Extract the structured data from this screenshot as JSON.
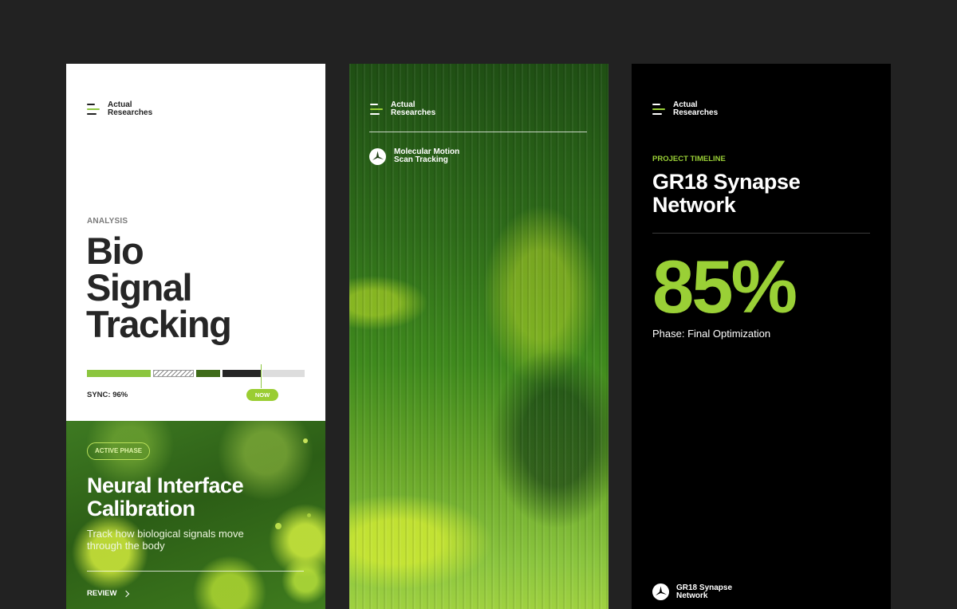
{
  "brand": {
    "line1": "Actual",
    "line2": "Researches"
  },
  "card1": {
    "eyebrow": "ANALYSIS",
    "title_lines": [
      "Bio",
      "Signal",
      "Tracking"
    ],
    "sync_label": "SYNC: 96%",
    "now_label": "NOW",
    "progress_segments": [
      {
        "type": "solid",
        "color": "#8cc63f"
      },
      {
        "type": "hatched",
        "color": "#cccccc"
      },
      {
        "type": "solid",
        "color": "#3f6b1a"
      },
      {
        "type": "solid",
        "color": "#262626"
      },
      {
        "type": "solid",
        "color": "#dddddd"
      }
    ],
    "phase_badge": "ACTIVE PHASE",
    "phase_title_lines": [
      "Neural Interface",
      "Calibration"
    ],
    "description": "Track how biological signals move through the body",
    "action_label": "REVIEW"
  },
  "card2": {
    "subtitle_lines": [
      "Molecular Motion",
      "Scan Tracking"
    ],
    "icon": "tri-blade-logo-icon"
  },
  "card3": {
    "eyebrow": "PROJECT TIMELINE",
    "title_lines": [
      "GR18 Synapse",
      "Network"
    ],
    "percent": "85%",
    "phase": "Phase: Final Optimization",
    "footer_lines": [
      "GR18 Synapse",
      "Network"
    ],
    "icon": "tri-blade-logo-icon"
  },
  "colors": {
    "accent": "#9ad036",
    "dark": "#262626",
    "background": "#222222"
  }
}
